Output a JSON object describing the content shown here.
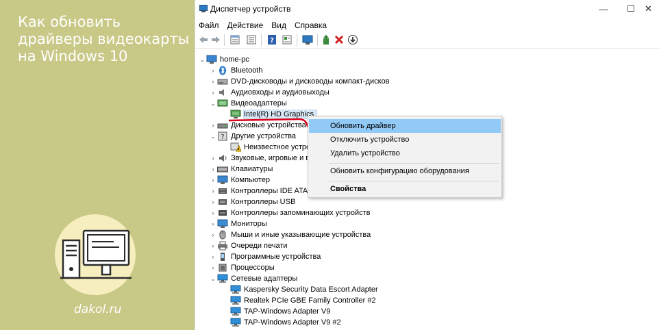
{
  "banner": {
    "title_lines": [
      "Как обновить",
      "драйверы видеокарты",
      "на Windows 10"
    ],
    "site": "dakol.ru"
  },
  "window": {
    "title": "Диспетчер устройств",
    "menu": [
      "Файл",
      "Действие",
      "Вид",
      "Справка"
    ]
  },
  "tree": {
    "root": "home-pc",
    "categories": [
      {
        "label": "Bluetooth",
        "icon": "bluetooth-icon",
        "expanded": false
      },
      {
        "label": "DVD-дисководы и дисководы компакт-дисков",
        "icon": "dvd-drive-icon",
        "expanded": false
      },
      {
        "label": "Аудиовходы и аудиовыходы",
        "icon": "speaker-icon",
        "expanded": false
      },
      {
        "label": "Видеоадаптеры",
        "icon": "display-adapter-icon",
        "expanded": true,
        "children": [
          "Intel(R) HD Graphics"
        ]
      },
      {
        "label": "Дисковые устройства",
        "icon": "disk-drive-icon",
        "expanded": false
      },
      {
        "label": "Другие устройства",
        "icon": "unknown-device-icon",
        "expanded": true,
        "children": [
          "Неизвестное устрой"
        ]
      },
      {
        "label": "Звуковые, игровые и ви",
        "icon": "sound-icon",
        "expanded": false
      },
      {
        "label": "Клавиатуры",
        "icon": "keyboard-icon",
        "expanded": false
      },
      {
        "label": "Компьютер",
        "icon": "computer-icon",
        "expanded": false
      },
      {
        "label": "Контроллеры IDE ATA/A",
        "icon": "ide-controller-icon",
        "expanded": false
      },
      {
        "label": "Контроллеры USB",
        "icon": "usb-icon",
        "expanded": false
      },
      {
        "label": "Контроллеры запоминающих устройств",
        "icon": "storage-controller-icon",
        "expanded": false
      },
      {
        "label": "Мониторы",
        "icon": "monitor-icon",
        "expanded": false
      },
      {
        "label": "Мыши и иные указывающие устройства",
        "icon": "mouse-icon",
        "expanded": false
      },
      {
        "label": "Очереди печати",
        "icon": "printer-icon",
        "expanded": false
      },
      {
        "label": "Программные устройства",
        "icon": "software-device-icon",
        "expanded": false
      },
      {
        "label": "Процессоры",
        "icon": "processor-icon",
        "expanded": false
      },
      {
        "label": "Сетевые адаптеры",
        "icon": "network-adapter-icon",
        "expanded": true,
        "children": [
          "Kaspersky Security Data Escort Adapter",
          "Realtek PCIe GBE Family Controller #2",
          "TAP-Windows Adapter V9",
          "TAP-Windows Adapter V9 #2"
        ]
      }
    ]
  },
  "context_menu": {
    "items": [
      "Обновить драйвер",
      "Отключить устройство",
      "Удалить устройство",
      "Обновить конфигурацию оборудования",
      "Свойства"
    ]
  },
  "colors": {
    "banner_bg": "#c8c887",
    "highlight": "#91c9f7",
    "annotation_red": "#d9001b"
  }
}
